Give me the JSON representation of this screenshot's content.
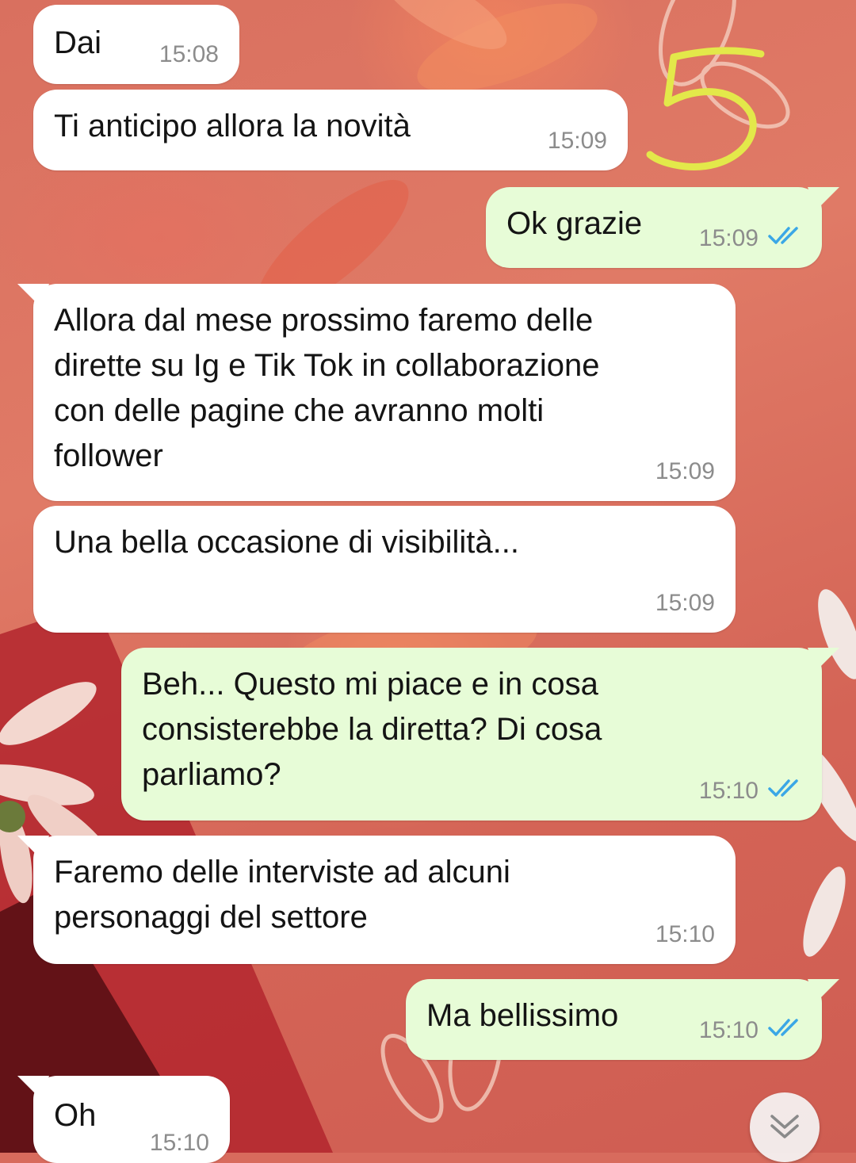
{
  "annotation": {
    "text": "5",
    "color": "#e3e84a"
  },
  "colors": {
    "incoming_bubble": "#ffffff",
    "outgoing_bubble": "#e7fcd7",
    "read_ticks": "#3ba7e6",
    "time_text": "#8c8c8c"
  },
  "messages": [
    {
      "direction": "incoming",
      "text": "Dai",
      "time": "15:08"
    },
    {
      "direction": "incoming",
      "text": "Ti anticipo allora la novità",
      "time": "15:09"
    },
    {
      "direction": "outgoing",
      "text": "Ok grazie",
      "time": "15:09",
      "status": "read"
    },
    {
      "direction": "incoming",
      "text": "Allora dal mese prossimo faremo delle\ndirette su Ig e Tik Tok in collaborazione\ncon delle pagine che avranno molti\nfollower",
      "time": "15:09"
    },
    {
      "direction": "incoming",
      "text": "Una bella occasione di visibilità...",
      "time": "15:09"
    },
    {
      "direction": "outgoing",
      "text": "Beh... Questo mi piace e in cosa\nconsisterebbe la diretta? Di cosa\nparliamo?",
      "time": "15:10",
      "status": "read"
    },
    {
      "direction": "incoming",
      "text": "Faremo delle interviste ad alcuni\npersonaggi del settore",
      "time": "15:10"
    },
    {
      "direction": "outgoing",
      "text": "Ma bellissimo",
      "time": "15:10",
      "status": "read"
    },
    {
      "direction": "incoming",
      "text": "Oh",
      "time": "15:10"
    }
  ],
  "scroll_button": {
    "icon": "double-chevron-down-icon"
  }
}
